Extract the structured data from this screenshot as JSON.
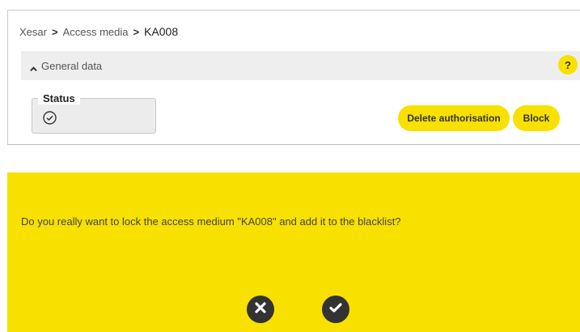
{
  "breadcrumb": {
    "items": [
      "Xesar",
      "Access media",
      "KA008"
    ],
    "separator": ">"
  },
  "section": {
    "title": "General data",
    "help_label": "?"
  },
  "status": {
    "label": "Status",
    "icon": "check-circle-icon"
  },
  "actions": {
    "delete_authorisation_label": "Delete authorisation",
    "block_label": "Block"
  },
  "dialog": {
    "message": "Do you really want to lock the access medium \"KA008\" and add it to the blacklist?",
    "cancel_icon": "close-circle-icon",
    "confirm_icon": "check-circle-icon"
  },
  "colors": {
    "accent_yellow": "#f8e000",
    "section_bg": "#eeeeee",
    "dark_icon": "#333333"
  }
}
